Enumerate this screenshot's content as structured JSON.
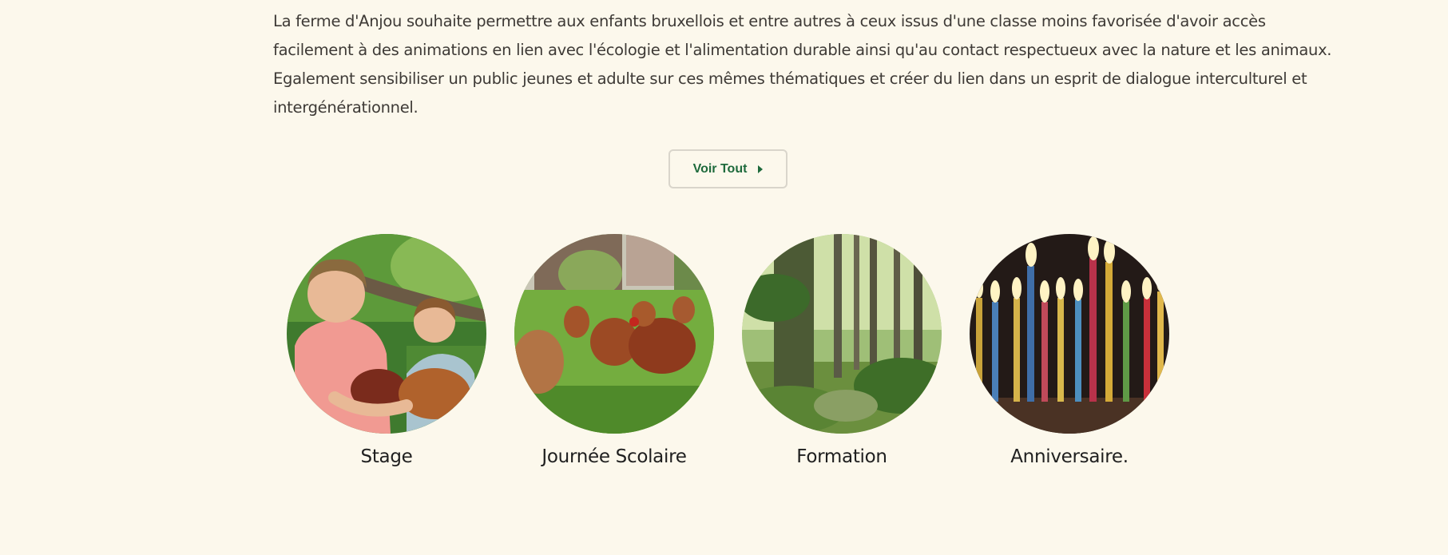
{
  "intro": {
    "lines": [
      "La ferme d'Anjou souhaite permettre aux enfants bruxellois et entre autres à ceux issus d'une classe  moins favorisée d'avoir accès",
      "facilement à des animations en lien avec l'écologie et l'alimentation durable ainsi qu'au contact respectueux avec la nature et les animaux.",
      "Egalement sensibiliser un public jeunes et adulte sur ces mêmes thématiques et créer du lien dans un esprit de dialogue interculturel et",
      "intergénérationnel."
    ]
  },
  "cta": {
    "label": "Voir Tout",
    "icon": "caret-right-icon",
    "color": "#1e6a3c"
  },
  "activities": [
    {
      "title": "Stage",
      "image": "children-holding-hens-photo"
    },
    {
      "title": "Journée Scolaire",
      "image": "hens-in-meadow-photo"
    },
    {
      "title": "Formation",
      "image": "forest-trees-photo"
    },
    {
      "title": "Anniversaire.",
      "image": "birthday-candles-photo"
    }
  ],
  "colors": {
    "background": "#fcf8ec",
    "text": "#3e3a36",
    "heading": "#1f1f1f"
  }
}
